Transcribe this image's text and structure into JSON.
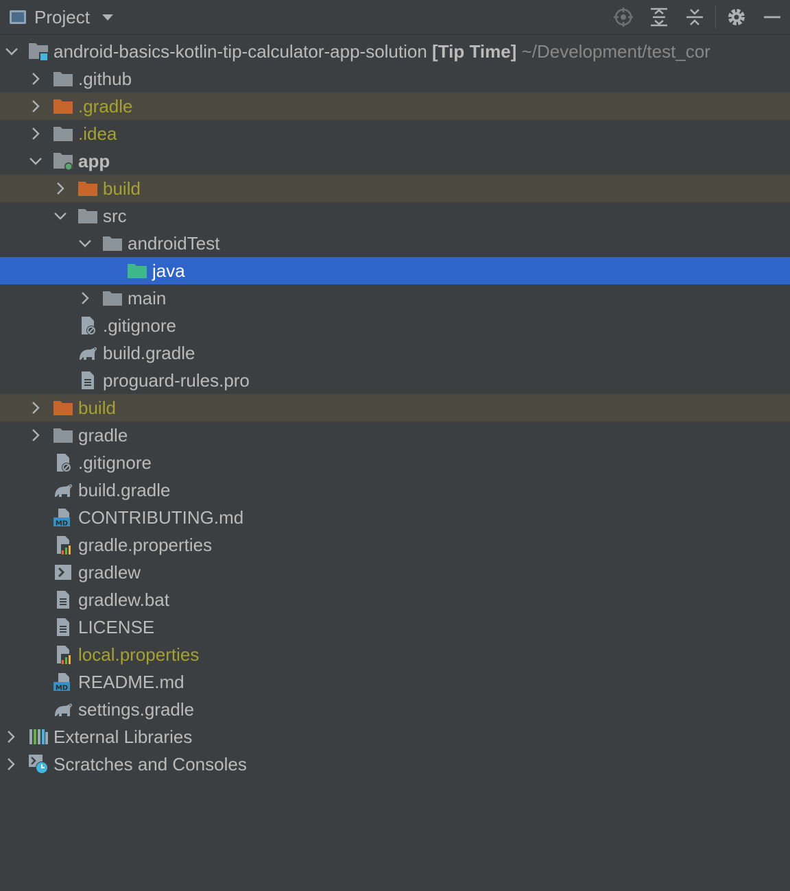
{
  "toolbar": {
    "title": "Project",
    "icons": [
      "locate-icon",
      "expand-all-icon",
      "collapse-all-icon",
      "gear-icon",
      "minimize-icon"
    ]
  },
  "colors": {
    "background": "#3c3f41",
    "selection": "#2f65ca",
    "excluded_row": "#4c4a40",
    "excluded_text": "#a5a22d",
    "folder": "#8c9399",
    "excluded_folder": "#c7652c",
    "test_folder": "#3fb78d"
  },
  "tree": {
    "root": {
      "name": "android-basics-kotlin-tip-calculator-app-solution",
      "module": "[Tip Time]",
      "path": "~/Development/test_cor"
    },
    "items": [
      {
        "label": ".github"
      },
      {
        "label": ".gradle"
      },
      {
        "label": ".idea"
      },
      {
        "label": "app"
      },
      {
        "label": "build"
      },
      {
        "label": "src"
      },
      {
        "label": "androidTest"
      },
      {
        "label": "java"
      },
      {
        "label": "main"
      },
      {
        "label": ".gitignore"
      },
      {
        "label": "build.gradle"
      },
      {
        "label": "proguard-rules.pro"
      },
      {
        "label": "build"
      },
      {
        "label": "gradle"
      },
      {
        "label": ".gitignore"
      },
      {
        "label": "build.gradle"
      },
      {
        "label": "CONTRIBUTING.md"
      },
      {
        "label": "gradle.properties"
      },
      {
        "label": "gradlew"
      },
      {
        "label": "gradlew.bat"
      },
      {
        "label": "LICENSE"
      },
      {
        "label": "local.properties"
      },
      {
        "label": "README.md"
      },
      {
        "label": "settings.gradle"
      },
      {
        "label": "External Libraries"
      },
      {
        "label": "Scratches and Consoles"
      }
    ]
  }
}
